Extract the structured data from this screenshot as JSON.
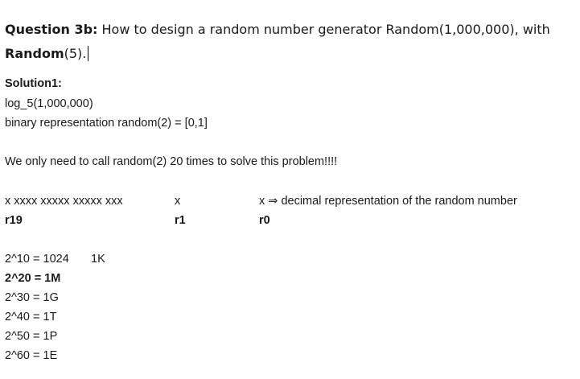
{
  "question": {
    "label": "Question 3b:",
    "text_part1": " How to design a random number generator Random(1,000,000), with",
    "label2": "Random",
    "text_part2": "(5)."
  },
  "solution": {
    "heading": "Solution1:",
    "line1": "log_5(1,000,000)",
    "line2": "binary representation  random(2) =  [0,1]",
    "line3": "We only need to call random(2)  20 times to solve this problem!!!!"
  },
  "bits_table": {
    "row1": {
      "col1": "x  xxxx xxxxx xxxxx xxx",
      "col2": "x",
      "col3": "x ⇒  decimal representation of the random number"
    },
    "row2": {
      "col1": "r19",
      "col2": "r1",
      "col3": "r0"
    }
  },
  "powers": [
    {
      "text": "2^10 = 1024",
      "note": "1K",
      "bold": false
    },
    {
      "text": "2^20 = 1M",
      "note": "",
      "bold": true
    },
    {
      "text": "2^30 = 1G",
      "note": "",
      "bold": false
    },
    {
      "text": "2^40 = 1T",
      "note": "",
      "bold": false
    },
    {
      "text": "2^50 = 1P",
      "note": "",
      "bold": false
    },
    {
      "text": "2^60 = 1E",
      "note": "",
      "bold": false
    }
  ]
}
